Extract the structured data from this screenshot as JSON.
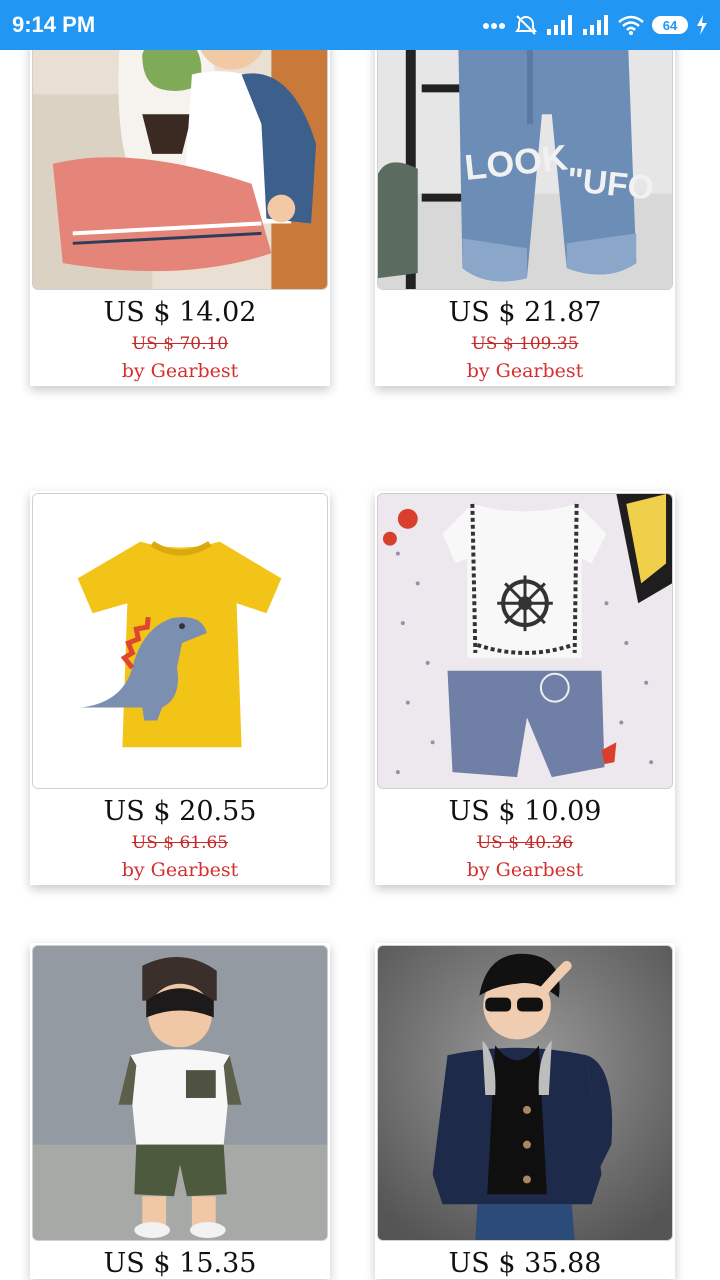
{
  "status_bar": {
    "time": "9:14 PM",
    "battery_level": "64",
    "icons": [
      "more-dots-icon",
      "alarm-off-icon",
      "signal-icon",
      "signal-icon-2",
      "wifi-icon",
      "battery-icon",
      "charging-icon"
    ]
  },
  "products": [
    {
      "price": "US $ 14.02",
      "old_price": "US $ 70.10",
      "seller": "by Gearbest"
    },
    {
      "price": "US $ 21.87",
      "old_price": "US $ 109.35",
      "seller": "by Gearbest"
    },
    {
      "price": "US $ 20.55",
      "old_price": "US $ 61.65",
      "seller": "by Gearbest"
    },
    {
      "price": "US $ 10.09",
      "old_price": "US $ 40.36",
      "seller": "by Gearbest"
    },
    {
      "price": "US $ 15.35"
    },
    {
      "price": "US $ 35.88"
    }
  ],
  "colors": {
    "status_bar": "#2196f3",
    "price_old": "#c62828",
    "seller": "#d32f2f"
  }
}
